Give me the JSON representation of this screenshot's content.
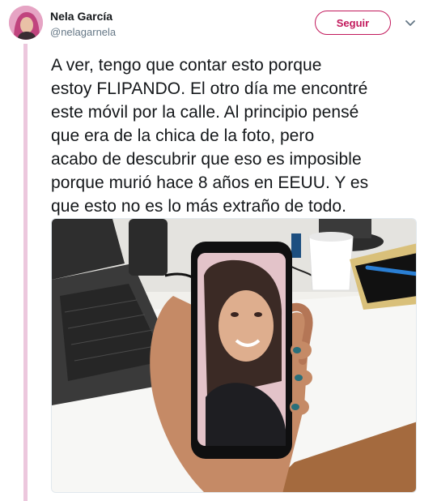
{
  "author": {
    "display_name": "Nela García",
    "handle": "@nelagarnela"
  },
  "actions": {
    "follow_label": "Seguir"
  },
  "icons": {
    "menu": "chevron-down-icon"
  },
  "tweet": {
    "lines": [
      "A ver, tengo que contar esto porque",
      "estoy FLIPANDO. El otro día me encontré",
      "este móvil por la calle. Al principio pensé",
      "que era de la chica de la foto, pero",
      "acabo de descubrir que eso es imposible",
      "porque murió hace 8 años en EEUU. Y es",
      "que esto no es lo más extraño de todo."
    ]
  },
  "colors": {
    "accent": "#c2185b",
    "thread_line": "#ecc7dd",
    "muted_text": "#657786"
  }
}
